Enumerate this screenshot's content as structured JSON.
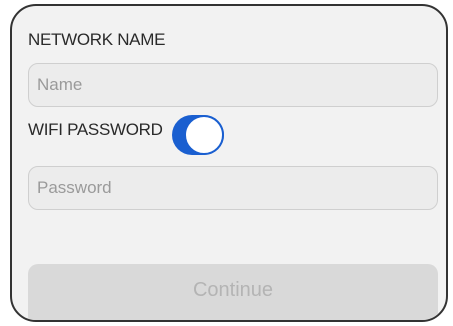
{
  "network": {
    "label": "NETWORK NAME",
    "name_value": "",
    "name_placeholder": "Name"
  },
  "wifi": {
    "label": "WIFI PASSWORD",
    "toggle_on": true,
    "password_value": "",
    "password_placeholder": "Password"
  },
  "actions": {
    "continue_label": "Continue"
  },
  "colors": {
    "accent": "#1a5fd0",
    "background": "#f2f2f2",
    "field_background": "#ececec",
    "button_disabled": "#d9d9d9"
  }
}
